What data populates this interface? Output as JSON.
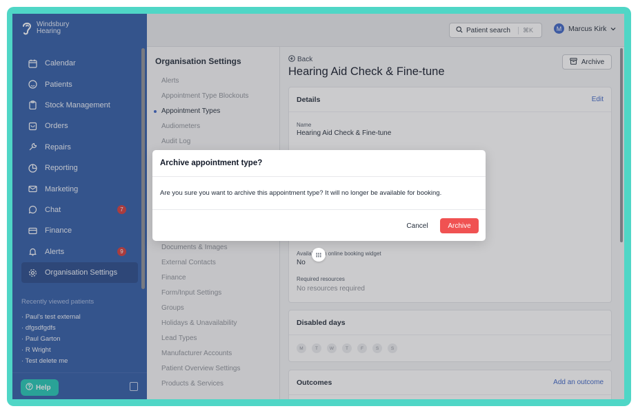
{
  "brand": {
    "name_line1": "Windsbury",
    "name_line2": "Hearing"
  },
  "sidebar": {
    "items": [
      {
        "label": "Calendar",
        "icon": "calendar-icon"
      },
      {
        "label": "Patients",
        "icon": "patients-icon"
      },
      {
        "label": "Stock Management",
        "icon": "clipboard-icon"
      },
      {
        "label": "Orders",
        "icon": "orders-icon"
      },
      {
        "label": "Repairs",
        "icon": "wrench-icon"
      },
      {
        "label": "Reporting",
        "icon": "pie-chart-icon"
      },
      {
        "label": "Marketing",
        "icon": "mail-icon"
      },
      {
        "label": "Chat",
        "icon": "chat-icon",
        "badge": "7"
      },
      {
        "label": "Finance",
        "icon": "card-icon"
      },
      {
        "label": "Alerts",
        "icon": "bell-icon",
        "badge": "9"
      },
      {
        "label": "Organisation Settings",
        "icon": "gear-icon",
        "active": true
      }
    ],
    "recent_title": "Recently viewed patients",
    "recent": [
      "Paul's test external",
      "dfgsdfgdfs",
      "Paul Garton",
      "R Wright",
      "Test delete me"
    ],
    "help_label": "Help"
  },
  "topbar": {
    "search_label": "Patient search",
    "search_shortcut": "⌘K",
    "user_initial": "M",
    "user_name": "Marcus Kirk"
  },
  "settings": {
    "title": "Organisation Settings",
    "items_top": [
      "Alerts",
      "Appointment Type Blockouts",
      "Appointment Types",
      "Audiometers",
      "Audit Log"
    ],
    "active": "Appointment Types",
    "items_bottom": [
      "Documents & Images",
      "External Contacts",
      "Finance",
      "Form/Input Settings",
      "Groups",
      "Holidays & Unavailability",
      "Lead Types",
      "Manufacturer Accounts",
      "Patient Overview Settings",
      "Products & Services"
    ]
  },
  "main": {
    "back_label": "Back",
    "title": "Hearing Aid Check & Fine-tune",
    "archive_label": "Archive",
    "details": {
      "title": "Details",
      "edit": "Edit",
      "name_label": "Name",
      "name_value": "Hearing Aid Check & Fine-tune",
      "online_label": "Available on online booking widget",
      "online_value": "No",
      "resources_label": "Required resources",
      "resources_value": "No resources required"
    },
    "disabled_days": {
      "title": "Disabled days",
      "days": [
        "M",
        "T",
        "W",
        "T",
        "F",
        "S",
        "S"
      ]
    },
    "outcomes": {
      "title": "Outcomes",
      "link": "Add an outcome"
    }
  },
  "modal": {
    "title": "Archive appointment type?",
    "body": "Are you sure you want to archive this appointment type? It will no longer be available for booking.",
    "cancel": "Cancel",
    "confirm": "Archive"
  },
  "colors": {
    "sidebar": "#2f5aa5",
    "accent": "#3b63c4",
    "danger": "#f05252",
    "help": "#21c7b5",
    "frame": "#4fd6c6"
  }
}
